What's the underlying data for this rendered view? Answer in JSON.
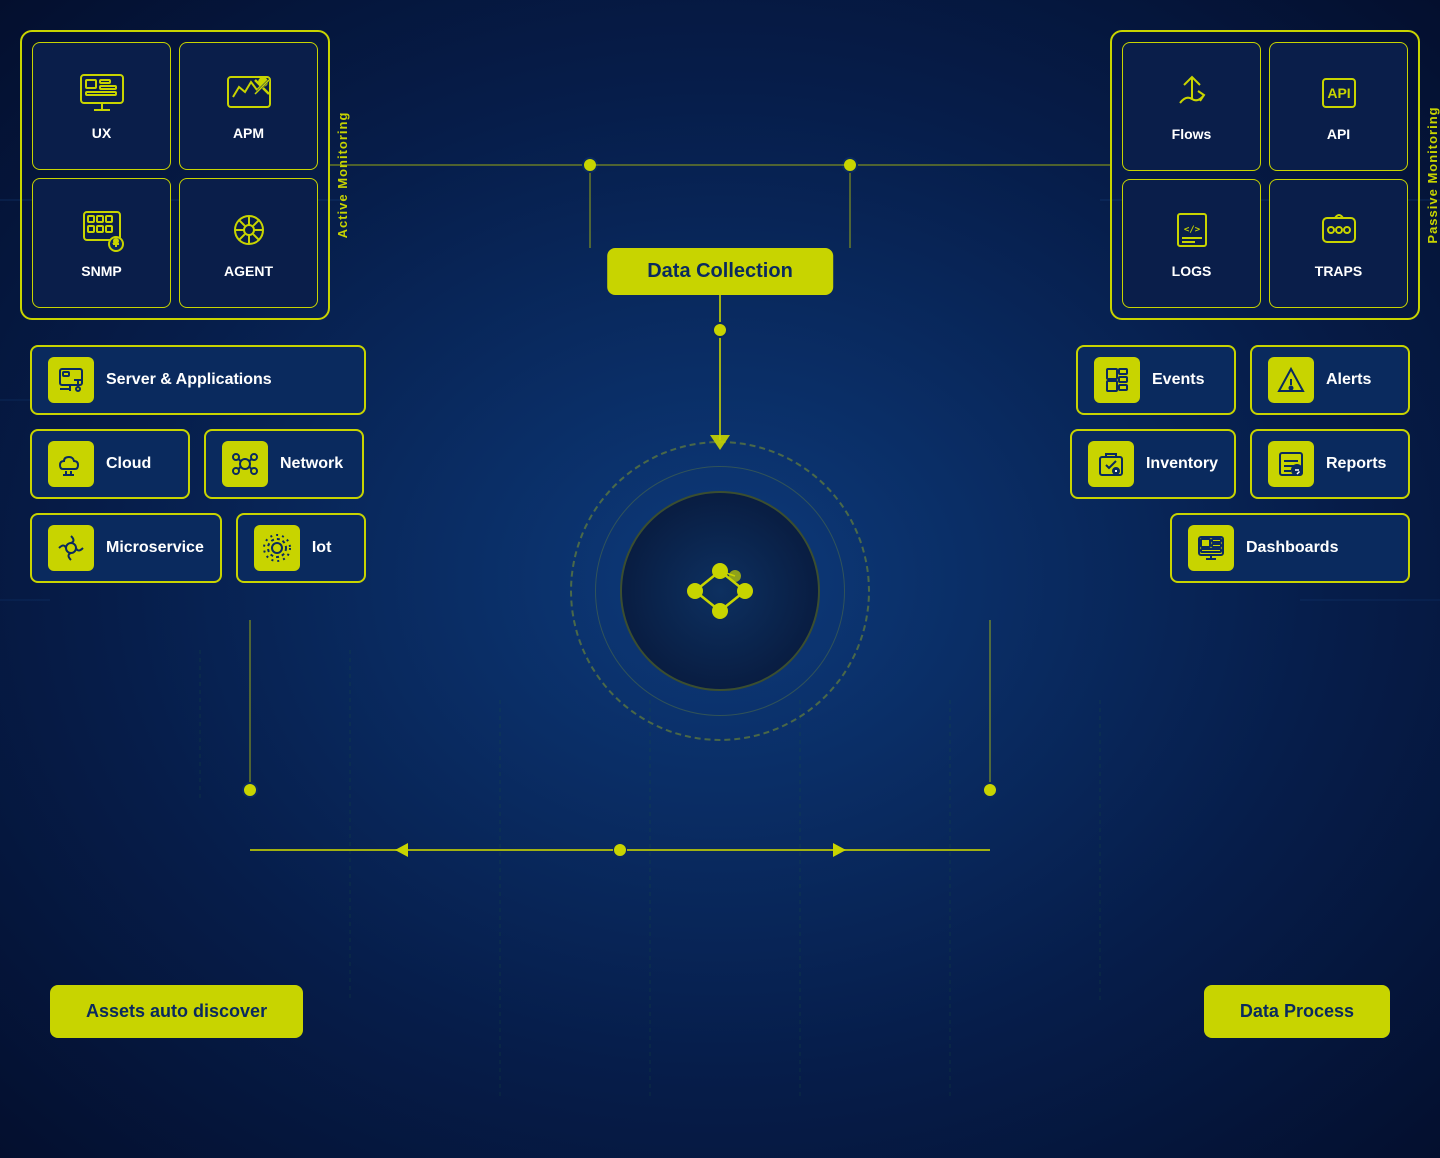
{
  "bg": {
    "color": "#0a2a5e"
  },
  "activeMonitoring": {
    "label": "Active Monitoring",
    "cards": [
      {
        "id": "ux",
        "label": "UX",
        "icon": "ux"
      },
      {
        "id": "apm",
        "label": "APM",
        "icon": "apm"
      },
      {
        "id": "snmp",
        "label": "SNMP",
        "icon": "snmp"
      },
      {
        "id": "agent",
        "label": "AGENT",
        "icon": "agent"
      }
    ]
  },
  "passiveMonitoring": {
    "label": "Passive Monitoring",
    "cards": [
      {
        "id": "flows",
        "label": "Flows",
        "icon": "flows"
      },
      {
        "id": "api",
        "label": "API",
        "icon": "api"
      },
      {
        "id": "logs",
        "label": "LOGS",
        "icon": "logs"
      },
      {
        "id": "traps",
        "label": "TRAPS",
        "icon": "traps"
      }
    ]
  },
  "dataCollection": {
    "label": "Data Collection"
  },
  "leftItems": [
    {
      "id": "server-applications",
      "label": "Server & Applications",
      "icon": "server"
    },
    {
      "id": "cloud",
      "label": "Cloud",
      "icon": "cloud"
    },
    {
      "id": "network",
      "label": "Network",
      "icon": "network"
    },
    {
      "id": "microservice",
      "label": "Microservice",
      "icon": "microservice"
    },
    {
      "id": "iot",
      "label": "Iot",
      "icon": "iot"
    }
  ],
  "rightItems": [
    {
      "id": "events",
      "label": "Events",
      "icon": "events"
    },
    {
      "id": "alerts",
      "label": "Alerts",
      "icon": "alerts"
    },
    {
      "id": "inventory",
      "label": "Inventory",
      "icon": "inventory"
    },
    {
      "id": "reports",
      "label": "Reports",
      "icon": "reports"
    },
    {
      "id": "dashboards",
      "label": "Dashboards",
      "icon": "dashboards"
    }
  ],
  "bottomLeft": {
    "label": "Assets auto discover"
  },
  "bottomRight": {
    "label": "Data Process"
  }
}
